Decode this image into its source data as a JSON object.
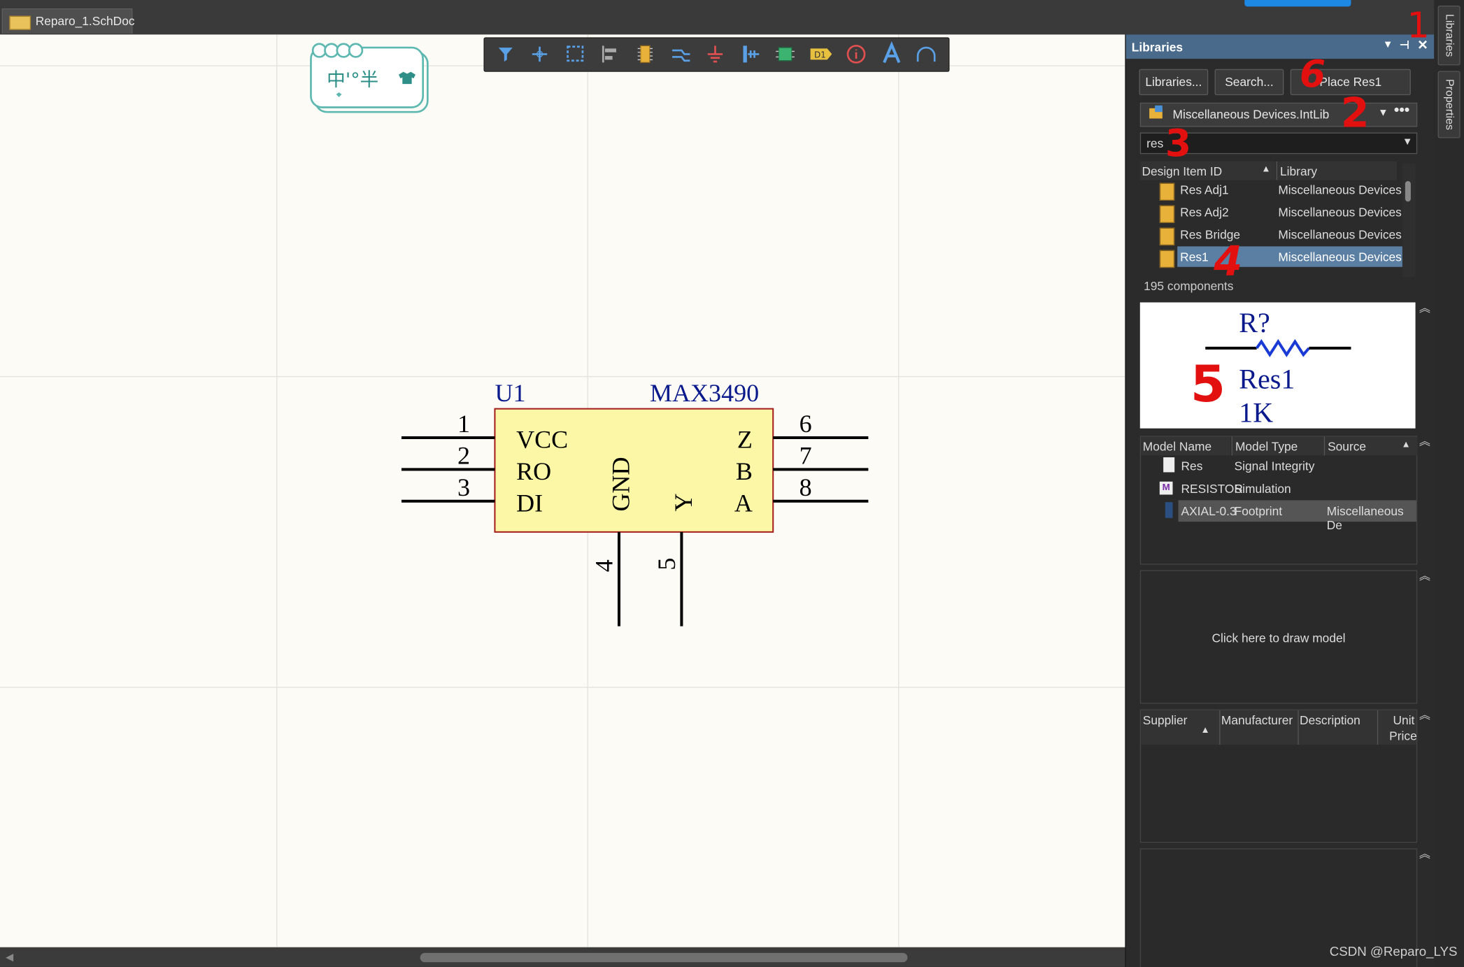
{
  "document_tab": {
    "label": "Reparo_1.SchDoc"
  },
  "toolbar": {
    "icons": [
      "filter-icon",
      "crosshair-icon",
      "select-rect-icon",
      "align-icon",
      "part-icon",
      "wire-icon",
      "gnd-icon",
      "bus-icon",
      "sheet-icon",
      "net-label-icon",
      "info-icon",
      "text-icon",
      "arc-icon"
    ],
    "net_label_text": "D1"
  },
  "stamp": {
    "text": "中'°半"
  },
  "schematic": {
    "designator": "U1",
    "comment": "MAX3490",
    "pins_left": [
      {
        "number": "1",
        "name": "VCC"
      },
      {
        "number": "2",
        "name": "RO"
      },
      {
        "number": "3",
        "name": "DI"
      }
    ],
    "pins_right": [
      {
        "number": "6",
        "name": "Z"
      },
      {
        "number": "7",
        "name": "B"
      },
      {
        "number": "8",
        "name": "A"
      }
    ],
    "pins_bottom": [
      {
        "number": "4",
        "name": "GND"
      },
      {
        "number": "5",
        "name": "Y"
      }
    ],
    "body_color": "#fcf7a6",
    "outline_color": "#a31b1b",
    "text_color": "#0a1a8c"
  },
  "panel": {
    "title": "Libraries",
    "buttons": {
      "libraries": "Libraries...",
      "search": "Search...",
      "place": "Place Res1"
    },
    "library_selector": "Miscellaneous Devices.IntLib",
    "filter_text": "res",
    "table_headers": {
      "design_item_id": "Design Item ID",
      "library": "Library"
    },
    "rows": [
      {
        "id": "Res Adj1",
        "library": "Miscellaneous Devices"
      },
      {
        "id": "Res Adj2",
        "library": "Miscellaneous Devices"
      },
      {
        "id": "Res Bridge",
        "library": "Miscellaneous Devices"
      },
      {
        "id": "Res1",
        "library": "Miscellaneous Devices",
        "selected": true
      }
    ],
    "component_count": "195 components",
    "preview": {
      "designator": "R?",
      "name": "Res1",
      "value": "1K"
    },
    "model_headers": {
      "name": "Model Name",
      "type": "Model Type",
      "source": "Source"
    },
    "models": [
      {
        "name": "Res",
        "type": "Signal Integrity",
        "source": ""
      },
      {
        "name": "RESISTOR",
        "type": "Simulation",
        "source": ""
      },
      {
        "name": "AXIAL-0.3",
        "type": "Footprint",
        "source": "Miscellaneous De"
      }
    ],
    "draw_model_text": "Click here to draw model",
    "supplier_headers": {
      "supplier": "Supplier",
      "manufacturer": "Manufacturer",
      "description": "Description",
      "unit": "Unit",
      "price": "Price"
    }
  },
  "side_tabs": {
    "libraries": "Libraries",
    "properties": "Properties"
  },
  "annotations": [
    "1",
    "2",
    "3",
    "4",
    "5",
    "6"
  ],
  "watermark": "CSDN @Reparo_LYS"
}
